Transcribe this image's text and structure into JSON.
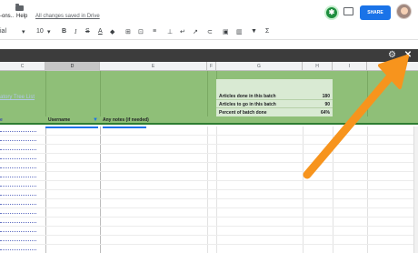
{
  "menu": {
    "addons": "-ons..",
    "help": "Help",
    "saved": "All changes saved in Drive"
  },
  "share": {
    "label": "SHARE"
  },
  "toolbar": {
    "font": "ial",
    "size": "10",
    "bold": "B",
    "italic": "I",
    "strike": "S",
    "text_color": "A"
  },
  "sidebar": {
    "settings_icon": "gear-icon",
    "close_icon": "close-icon"
  },
  "columns": [
    "C",
    "D",
    "E",
    "F",
    "G",
    "H",
    "I"
  ],
  "banner": {
    "title_link": "atory Tree List"
  },
  "stats": [
    {
      "label": "Articles done in this batch",
      "value": "180"
    },
    {
      "label": "Articles to go in this batch",
      "value": "90"
    },
    {
      "label": "Percent of batch done",
      "value": "64%"
    }
  ],
  "table_header": {
    "left": "e",
    "username": "Username",
    "notes": "Any notes (if needed)"
  },
  "colors": {
    "banner_green": "#8fbf78",
    "stats_green": "#d9ead3",
    "arrow_orange": "#f7941d",
    "share_blue": "#1a73e8"
  }
}
